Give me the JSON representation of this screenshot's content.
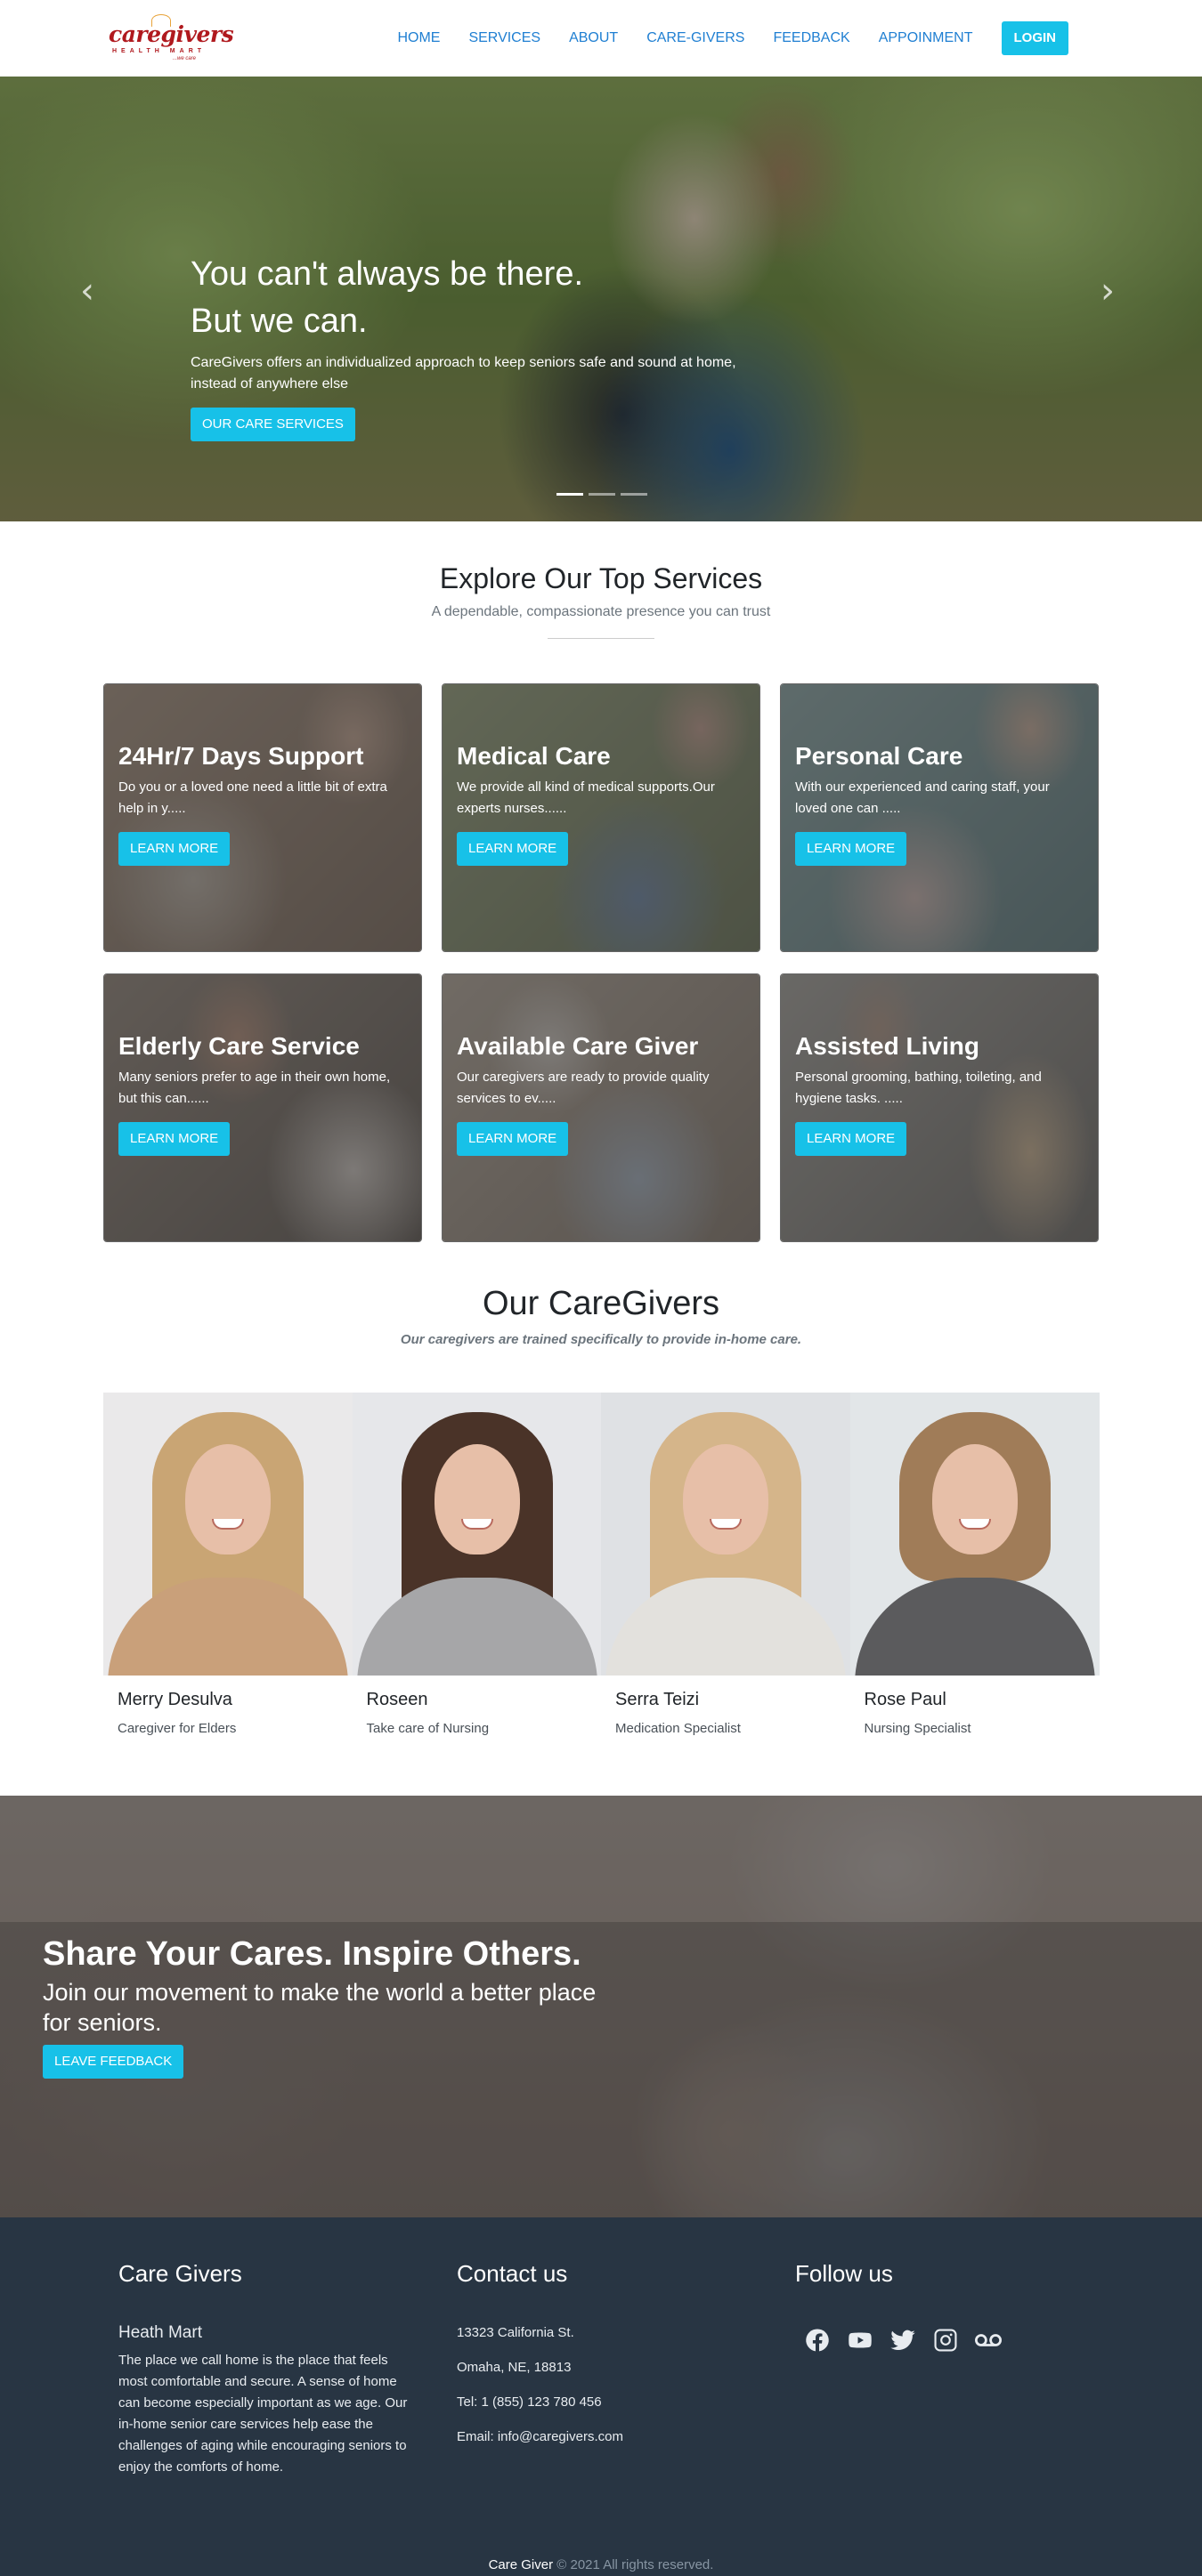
{
  "brand": {
    "logo_name": "caregivers",
    "logo_sub": "HEALTH MART",
    "logo_tag": "...we care"
  },
  "nav": {
    "links": [
      "HOME",
      "SERVICES",
      "ABOUT",
      "CARE-GIVERS",
      "FEEDBACK",
      "APPOINMENT"
    ],
    "login": "LOGIN"
  },
  "hero": {
    "title_line1": "You can't always be there.",
    "title_line2": "But we can.",
    "description": "CareGivers offers an individualized approach to keep seniors safe and sound at home, instead of anywhere else",
    "button": "OUR CARE SERVICES",
    "prev_icon": "chevron-left-icon",
    "next_icon": "chevron-right-icon",
    "slides": 3,
    "active_slide": 1
  },
  "services": {
    "title": "Explore Our Top Services",
    "subtitle": "A dependable, compassionate presence you can trust",
    "cards": [
      {
        "title": "24Hr/7 Days Support",
        "text": "Do you or a loved one need a little bit of extra help in y.....",
        "button": "LEARN MORE"
      },
      {
        "title": "Medical Care",
        "text": "We provide all kind of medical supports.Our experts nurses......",
        "button": "LEARN MORE"
      },
      {
        "title": "Personal Care",
        "text": "With our experienced and caring staff, your loved one can .....",
        "button": "LEARN MORE"
      },
      {
        "title": "Elderly Care Service",
        "text": "Many seniors prefer to age in their own home, but this can......",
        "button": "LEARN MORE"
      },
      {
        "title": "Available Care Giver",
        "text": "Our caregivers are ready to provide quality services to ev.....",
        "button": "LEARN MORE"
      },
      {
        "title": "Assisted Living",
        "text": "Personal grooming, bathing, toileting, and hygiene tasks. .....",
        "button": "LEARN MORE"
      }
    ]
  },
  "caregivers": {
    "title": "Our CareGivers",
    "subtitle": "Our caregivers are trained specifically to provide in-home care.",
    "members": [
      {
        "name": "Merry Desulva",
        "role": "Caregiver for Elders"
      },
      {
        "name": "Roseen",
        "role": "Take care of Nursing"
      },
      {
        "name": "Serra Teizi",
        "role": "Medication Specialist"
      },
      {
        "name": "Rose Paul",
        "role": "Nursing Specialist"
      }
    ]
  },
  "feedback": {
    "title": "Share Your Cares. Inspire Others.",
    "subtitle": "Join our movement to make the world a better place for seniors.",
    "button": "LEAVE FEEDBACK"
  },
  "footer": {
    "col1_title": "Care Givers",
    "col1_sub": "Heath Mart",
    "col1_text": "The place we call home is the place that feels most comfortable and secure. A sense of home can become especially important as we age. Our in-home senior care services help ease the challenges of aging while encouraging seniors to enjoy the comforts of home.",
    "col2_title": "Contact us",
    "address1": "13323 California St.",
    "address2": "Omaha, NE, 18813",
    "tel": "Tel: 1 (855) 123 780 456",
    "email": "Email: info@caregivers.com",
    "col3_title": "Follow us",
    "socials": [
      "facebook-icon",
      "youtube-icon",
      "twitter-icon",
      "instagram-icon",
      "voicemail-icon"
    ],
    "copy_brand": "Care Giver",
    "copy_text": " © 2021 All rights reserved."
  },
  "colors": {
    "accent": "#17c1e8",
    "nav_link": "#1f7fd2",
    "footer_bg": "#283543",
    "logo_red": "#b0191e"
  }
}
